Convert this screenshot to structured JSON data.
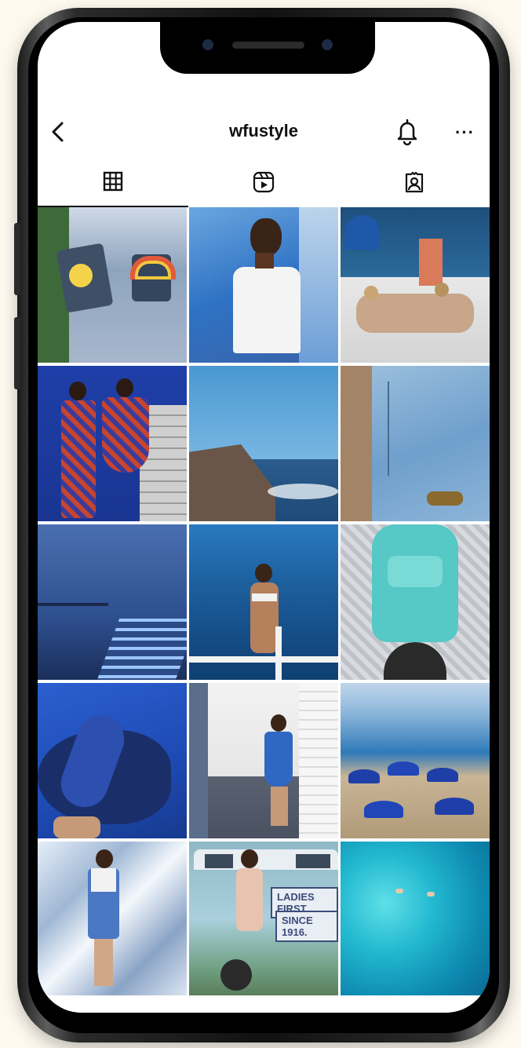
{
  "profile": {
    "username": "wfustyle"
  },
  "header": {
    "back_icon": "chevron-left-icon",
    "bell_icon": "bell-icon",
    "more_label": "···"
  },
  "tabs": [
    {
      "name": "grid-posts",
      "icon": "grid-icon",
      "selected": true
    },
    {
      "name": "reels",
      "icon": "reels-icon",
      "selected": false
    },
    {
      "name": "tagged",
      "icon": "tagged-person-icon",
      "selected": false
    }
  ],
  "posts": [
    {
      "id": 1,
      "scene": "patched-denim-jeans"
    },
    {
      "id": 2,
      "scene": "woman-blue-alley"
    },
    {
      "id": 3,
      "scene": "friends-santorini"
    },
    {
      "id": 4,
      "scene": "two-women-blue-wall"
    },
    {
      "id": 5,
      "scene": "rocky-coast-sea"
    },
    {
      "id": 6,
      "scene": "blue-handbag"
    },
    {
      "id": 7,
      "scene": "blue-lit-stairs"
    },
    {
      "id": 8,
      "scene": "woman-boat-ocean"
    },
    {
      "id": 9,
      "scene": "turquoise-vespa"
    },
    {
      "id": 10,
      "scene": "blue-jacket-fur"
    },
    {
      "id": 11,
      "scene": "woman-white-wall"
    },
    {
      "id": 12,
      "scene": "beach-umbrellas"
    },
    {
      "id": 13,
      "scene": "woman-silver-room"
    },
    {
      "id": 14,
      "scene": "woman-blue-van",
      "sign_line1": "LADIES FIRST",
      "sign_line2": "SINCE 1916."
    },
    {
      "id": 15,
      "scene": "turquoise-water-swimmers"
    }
  ],
  "colors": {
    "background": "#fdf9ee",
    "frame": "#1a1a1a",
    "text": "#111111"
  }
}
